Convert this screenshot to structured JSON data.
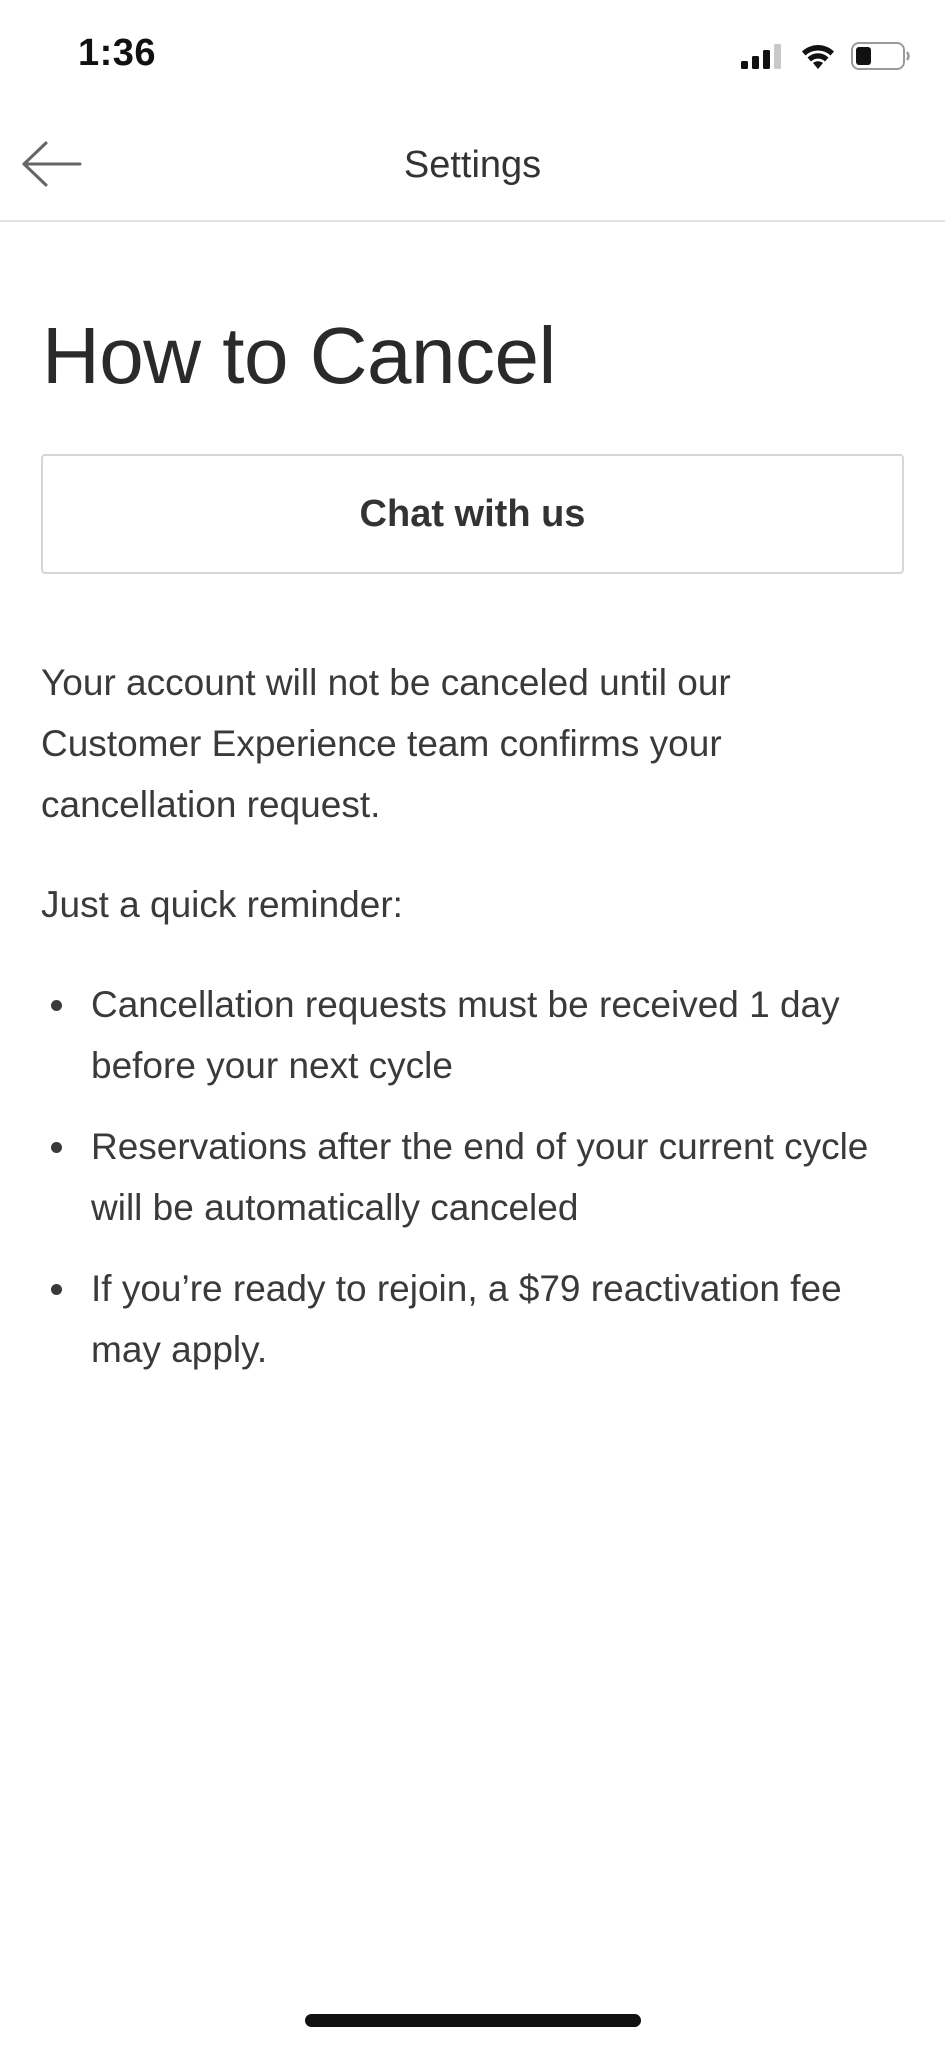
{
  "status_bar": {
    "time": "1:36"
  },
  "header": {
    "title": "Settings",
    "back_icon": "arrow-left-icon"
  },
  "main": {
    "title": "How to Cancel",
    "chat_button_label": "Chat with us",
    "intro_text": "Your account will not be canceled until our Customer Experience team confirms your cancellation request.",
    "reminder_heading": "Just a quick reminder:",
    "reminders": [
      "Cancellation requests must be received 1 day before your next cycle",
      "Reservations after the end of your current cycle will be automatically canceled",
      "If you’re ready to rejoin, a $79 reactivation fee may apply."
    ]
  },
  "colors": {
    "text_primary": "#2b2b2b",
    "divider": "#e3e3e3",
    "button_border": "#d6d6d6"
  }
}
